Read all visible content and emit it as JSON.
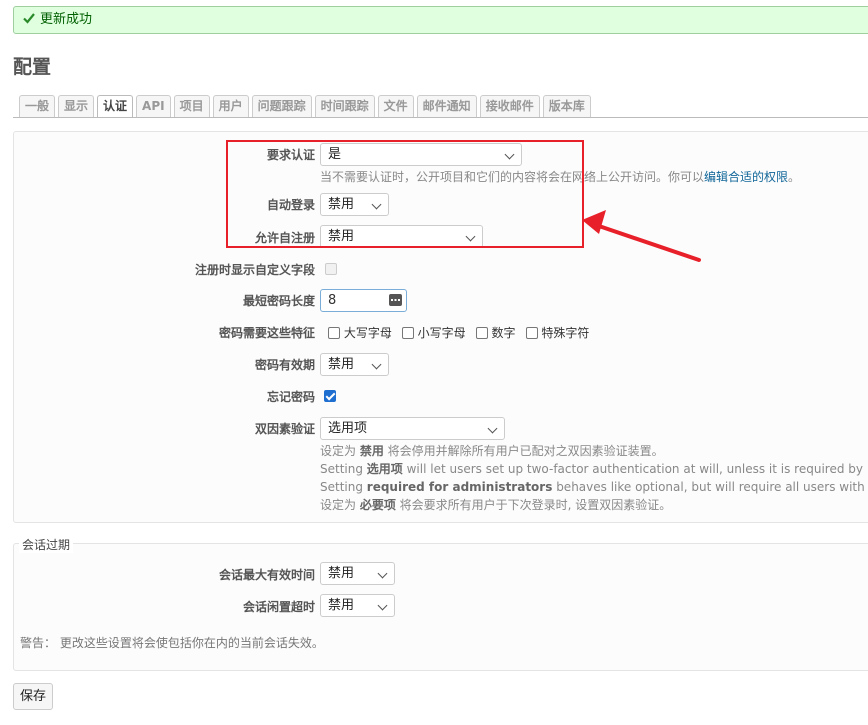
{
  "flash": {
    "message": "更新成功",
    "icon": "checkmark-icon"
  },
  "page_title": "配置",
  "tabs": [
    {
      "label": "一般"
    },
    {
      "label": "显示"
    },
    {
      "label": "认证"
    },
    {
      "label": "API"
    },
    {
      "label": "项目"
    },
    {
      "label": "用户"
    },
    {
      "label": "问题跟踪"
    },
    {
      "label": "时间跟踪"
    },
    {
      "label": "文件"
    },
    {
      "label": "邮件通知"
    },
    {
      "label": "接收邮件"
    },
    {
      "label": "版本库"
    }
  ],
  "auth": {
    "login_required": {
      "label": "要求认证",
      "value": "是"
    },
    "login_required_hint": "当不需要认证时，公开项目和它们的内容将会在网络上公开访问。你可以",
    "login_required_link": "编辑合适的权限",
    "login_required_hint_end": "。",
    "autologin": {
      "label": "自动登录",
      "value": "禁用"
    },
    "self_registration": {
      "label": "允许自注册",
      "value": "禁用"
    },
    "show_custom_fields": {
      "label": "注册时显示自定义字段"
    },
    "min_password_length": {
      "label": "最短密码长度",
      "value": "8"
    },
    "password_required_chars": {
      "label": "密码需要这些特征",
      "options": [
        "大写字母",
        "小写字母",
        "数字",
        "特殊字符"
      ]
    },
    "password_max_age": {
      "label": "密码有效期",
      "value": "禁用"
    },
    "lost_password": {
      "label": "忘记密码",
      "checked": true
    },
    "twofa": {
      "label": "双因素验证",
      "value": "选用项",
      "notes": [
        {
          "pre": "设定为 ",
          "strong": "禁用",
          "post": " 将会停用并解除所有用户已配对之双因素验证装置。"
        },
        {
          "pre": "Setting ",
          "strong": "选用项",
          "post": " will let users set up two-factor authentication at will, unless it is required by"
        },
        {
          "pre": "Setting ",
          "strong": "required for administrators",
          "post": " behaves like optional, but will require all users with"
        },
        {
          "pre": "设定为 ",
          "strong": "必要项",
          "post": " 将会要求所有用户于下次登录时, 设置双因素验证。"
        }
      ]
    }
  },
  "session": {
    "legend": "会话过期",
    "lifetime": {
      "label": "会话最大有效时间",
      "value": "禁用"
    },
    "timeout": {
      "label": "会话闲置超时",
      "value": "禁用"
    },
    "warning": "警告：  更改这些设置将会使包括你在内的当前会话失效。"
  },
  "save_label": "保存",
  "colors": {
    "annotation": "#e8202a",
    "link": "#116699",
    "checkbox_checked": "#1f6fd0",
    "flash_bg": "#dfffdf"
  }
}
